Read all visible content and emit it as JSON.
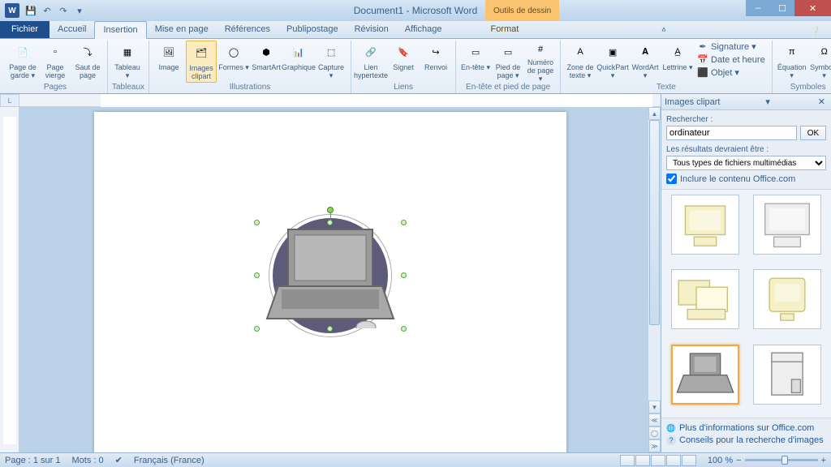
{
  "window": {
    "title": "Document1 - Microsoft Word",
    "contextual_tab_group": "Outils de dessin"
  },
  "qat": {
    "save": "💾",
    "undo": "↶",
    "redo": "↷"
  },
  "tabs": {
    "file": "Fichier",
    "items": [
      "Accueil",
      "Insertion",
      "Mise en page",
      "Références",
      "Publipostage",
      "Révision",
      "Affichage"
    ],
    "active": "Insertion",
    "contextual": "Format"
  },
  "ribbon": {
    "groups": [
      {
        "label": "Pages",
        "items": [
          {
            "label": "Page de\ngarde ▾",
            "icon": "📄"
          },
          {
            "label": "Page\nvierge",
            "icon": "▫"
          },
          {
            "label": "Saut de\npage",
            "icon": "⤵"
          }
        ]
      },
      {
        "label": "Tableaux",
        "items": [
          {
            "label": "Tableau\n▾",
            "icon": "▦"
          }
        ]
      },
      {
        "label": "Illustrations",
        "items": [
          {
            "label": "Image",
            "icon": "🖼"
          },
          {
            "label": "Images\nclipart",
            "icon": "🗂",
            "selected": true
          },
          {
            "label": "Formes\n▾",
            "icon": "◯"
          },
          {
            "label": "SmartArt",
            "icon": "⬢"
          },
          {
            "label": "Graphique",
            "icon": "📊"
          },
          {
            "label": "Capture\n▾",
            "icon": "⬚"
          }
        ]
      },
      {
        "label": "Liens",
        "items": [
          {
            "label": "Lien\nhypertexte",
            "icon": "🔗"
          },
          {
            "label": "Signet",
            "icon": "🔖"
          },
          {
            "label": "Renvoi",
            "icon": "↪"
          }
        ]
      },
      {
        "label": "En-tête et pied de page",
        "items": [
          {
            "label": "En-tête\n▾",
            "icon": "▭"
          },
          {
            "label": "Pied de\npage ▾",
            "icon": "▭"
          },
          {
            "label": "Numéro\nde page ▾",
            "icon": "#"
          }
        ]
      },
      {
        "label": "Texte",
        "items": [
          {
            "label": "Zone de\ntexte ▾",
            "icon": "A"
          },
          {
            "label": "QuickPart\n▾",
            "icon": "▣"
          },
          {
            "label": "WordArt\n▾",
            "icon": "𝐀"
          },
          {
            "label": "Lettrine\n▾",
            "icon": "A̲"
          }
        ],
        "small": [
          {
            "label": "Signature ▾",
            "icon": "✒"
          },
          {
            "label": "Date et heure",
            "icon": "📅"
          },
          {
            "label": "Objet ▾",
            "icon": "⬛"
          }
        ]
      },
      {
        "label": "Symboles",
        "items": [
          {
            "label": "Équation\n▾",
            "icon": "π"
          },
          {
            "label": "Symbole\n▾",
            "icon": "Ω"
          }
        ]
      }
    ]
  },
  "clipart_pane": {
    "title": "Images clipart",
    "search_label": "Rechercher :",
    "search_value": "ordinateur",
    "ok": "OK",
    "results_label": "Les résultats devraient être :",
    "filter": "Tous types de fichiers multimédias",
    "include_office": "Inclure le contenu Office.com",
    "link1": "Plus d'informations sur Office.com",
    "link2": "Conseils pour la recherche d'images",
    "selected_index": 4
  },
  "status": {
    "page": "Page : 1 sur 1",
    "words": "Mots : 0",
    "lang": "Français (France)",
    "zoom": "100 %"
  }
}
